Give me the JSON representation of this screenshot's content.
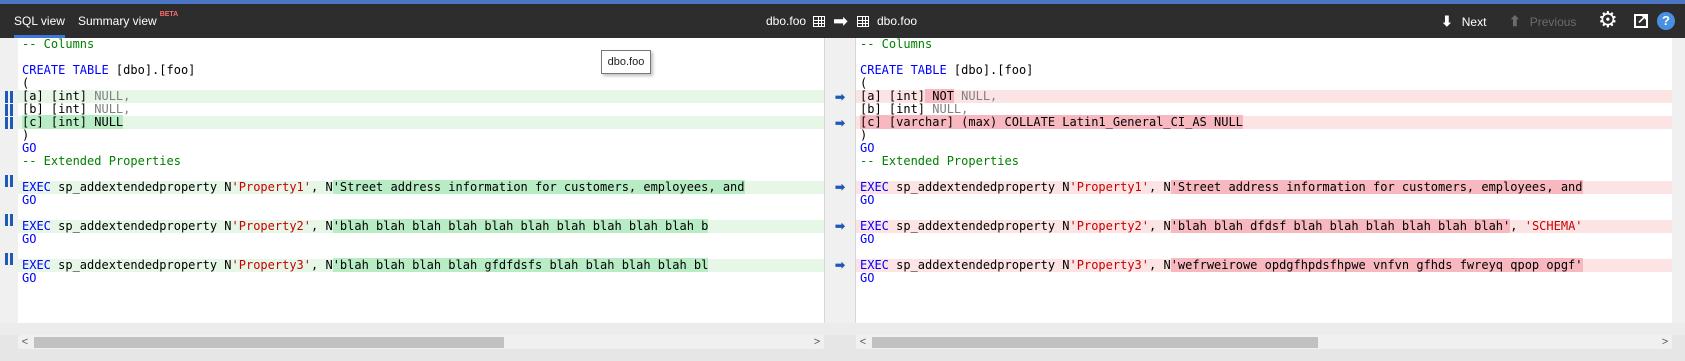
{
  "toolbar": {
    "tabs": [
      {
        "label": "SQL view",
        "active": true
      },
      {
        "label": "Summary view",
        "badge": "BETA",
        "active": false
      }
    ],
    "source_object": "dbo.foo",
    "target_object": "dbo.foo",
    "next_label": "Next",
    "previous_label": "Previous",
    "icons": [
      "table-icon",
      "arrow-right-icon",
      "gear-icon",
      "popout-icon",
      "help-icon"
    ]
  },
  "tooltip": {
    "text": "dbo.foo"
  },
  "help_glyph": "?",
  "colors": {
    "accent": "#3b78d8",
    "added_line": "#e6f7e8",
    "added_highlight": "#b8ecc4",
    "removed_line": "#fde4e4",
    "removed_highlight": "#f8b8c0",
    "keyword": "#0000ff",
    "string": "#c80000",
    "comment": "#008000",
    "gutter_marker": "#1e5ab4"
  },
  "left": {
    "columns_comment": "-- Columns",
    "create_kw": "CREATE TABLE",
    "create_name": " [dbo].[foo]",
    "open_paren": "(",
    "col_a": "[a] [int]",
    "col_a_null": " NULL,",
    "col_b": "[b] [int]",
    "col_b_null": " NULL,",
    "col_c": "[c] [int] NULL",
    "close_paren": ")",
    "go1": "GO",
    "ext_comment": "-- Extended Properties",
    "exec_kw": "EXEC",
    "proc": " sp_addextendedproperty ",
    "n_prefix": "N",
    "comma_n": ", N",
    "p1_name": "'Property1'",
    "p1_value": "'Street address information for customers, employees, and",
    "p2_name": "'Property2'",
    "p2_value": "'blah blah blah blah blah blah blah blah blah blah b",
    "p3_name": "'Property3'",
    "p3_value": "'blah blah blah blah gfdfdsfs blah blah blah blah bl",
    "go": "GO"
  },
  "right": {
    "columns_comment": "-- Columns",
    "create_kw": "CREATE TABLE",
    "create_name": " [dbo].[foo]",
    "open_paren": "(",
    "col_a": "[a] [int]",
    "col_a_not": " NOT",
    "col_a_null": " NULL,",
    "col_b": "[b] [int]",
    "col_b_null": " NULL,",
    "col_c": "[c] [varchar] (max) COLLATE Latin1_General_CI_AS NULL",
    "close_paren": ")",
    "go1": "GO",
    "ext_comment": "-- Extended Properties",
    "exec_kw": "EXEC",
    "proc": " sp_addextendedproperty ",
    "n_prefix": "N",
    "comma_n": ", N",
    "p1_name": "'Property1'",
    "p1_value": "'Street address information for customers, employees, and",
    "p2_name": "'Property2'",
    "p2_value": "'blah blah dfdsf blah blah blah blah blah blah'",
    "p2_tail_sep": ", ",
    "p2_tail": "'SCHEMA'",
    "p3_name": "'Property3'",
    "p3_value": "'wefrweirowe opdgfhpdsfhpwe vnfvn gfhds fwreyq qpop opgf'",
    "go": "GO"
  }
}
